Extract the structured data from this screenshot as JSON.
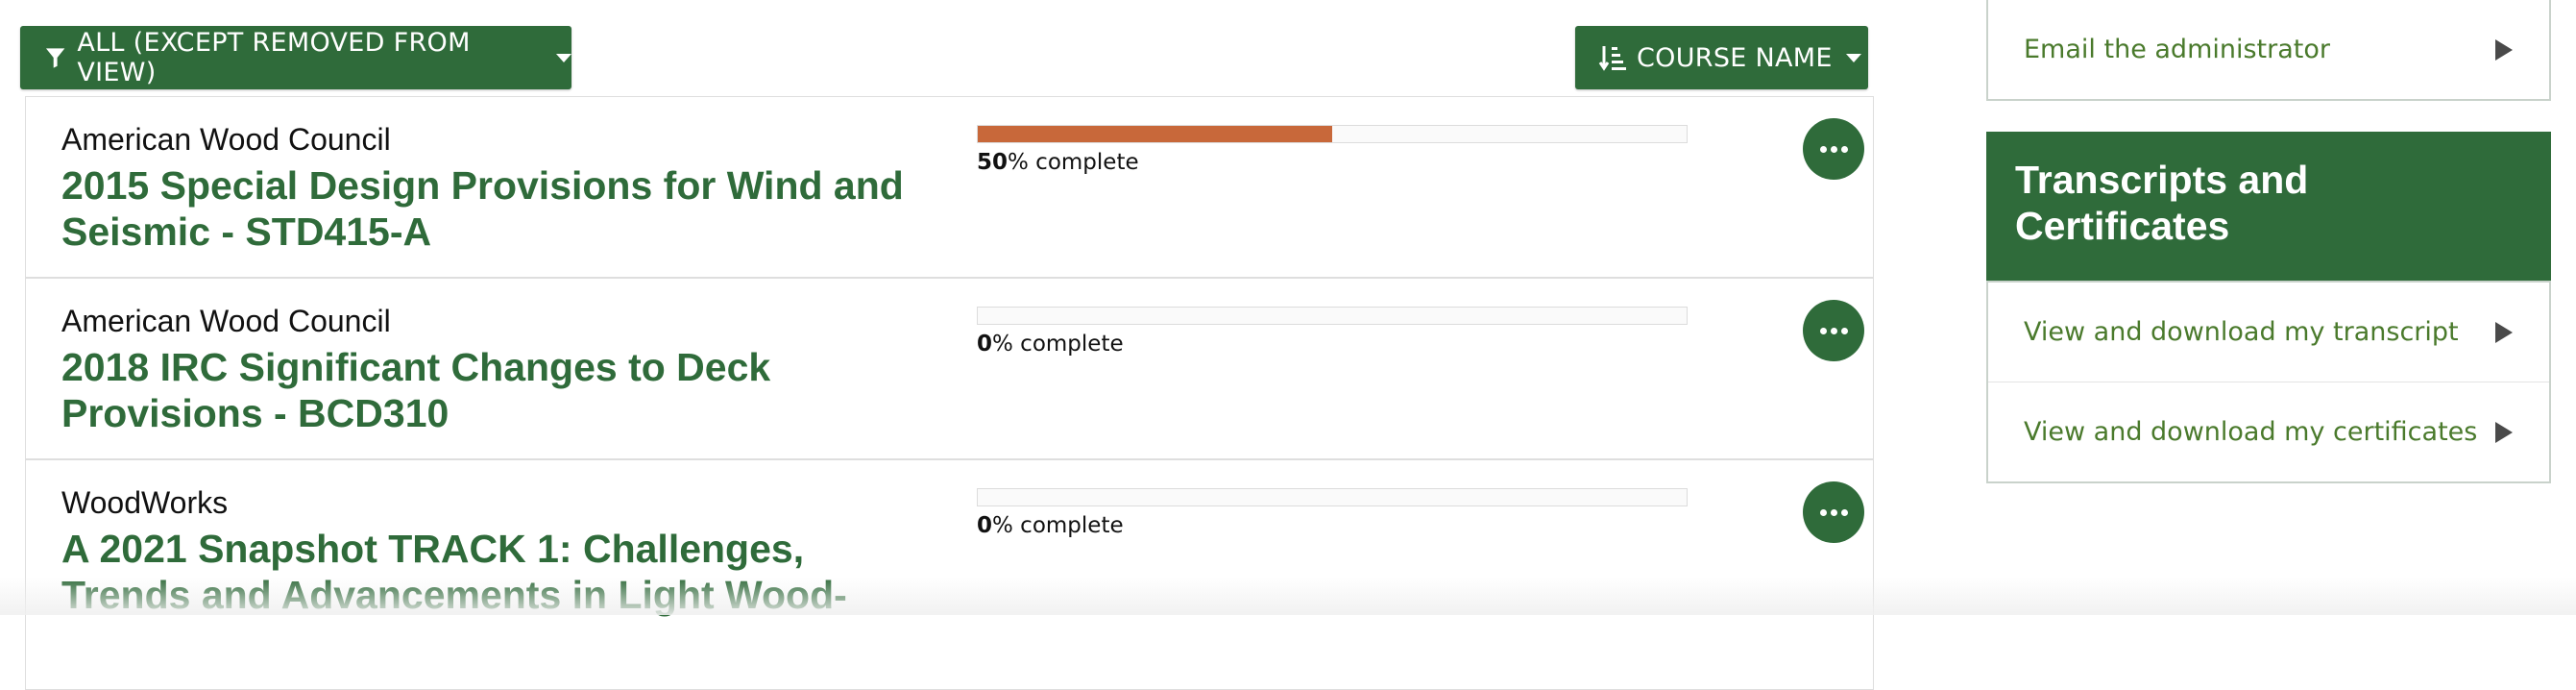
{
  "toolbar": {
    "filter_label": "ALL (EXCEPT REMOVED FROM VIEW)",
    "sort_label": "COURSE NAME"
  },
  "courses": [
    {
      "provider": "American Wood Council",
      "title": "2015 Special Design Provisions for Wind and Seismic - STD415-A",
      "progress_value": "50",
      "progress_suffix": "% complete",
      "progress": 0.5
    },
    {
      "provider": "American Wood Council",
      "title": "2018 IRC Significant Changes to Deck Provisions - BCD310",
      "progress_value": "0",
      "progress_suffix": "% complete",
      "progress": 0
    },
    {
      "provider": "WoodWorks",
      "title": "A 2021 Snapshot TRACK 1: Challenges, Trends and Advancements in Light Wood-",
      "progress_value": "0",
      "progress_suffix": "% complete",
      "progress": 0
    }
  ],
  "sidebar": {
    "email_admin": "Email the administrator",
    "transcripts_heading": "Transcripts and Certificates",
    "view_transcript": "View and download my transcript",
    "view_certificates": "View and download my certificates"
  },
  "colors": {
    "brand_green": "#2f6b3a",
    "progress_orange": "#c8683a",
    "link_green": "#4a7a2c"
  }
}
